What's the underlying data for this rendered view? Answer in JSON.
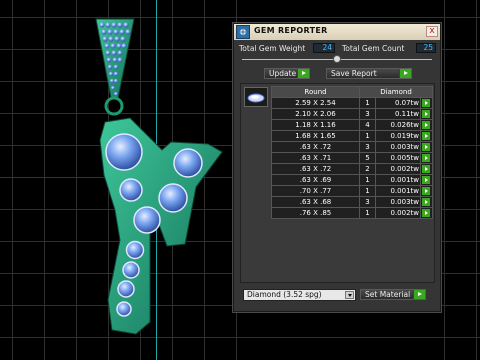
{
  "panel": {
    "title": "GEM REPORTER",
    "close_glyph": "x",
    "total_weight_label": "Total Gem Weight",
    "total_weight_value": "24",
    "total_count_label": "Total Gem Count",
    "total_count_value": "25",
    "update_label": "Update",
    "save_label": "Save Report",
    "table": {
      "headers": [
        "Round",
        "Diamond"
      ],
      "rows": [
        {
          "size": "2.59 X 2.54",
          "count": "1",
          "weight": "0.07tw"
        },
        {
          "size": "2.10 X 2.06",
          "count": "3",
          "weight": "0.11tw"
        },
        {
          "size": "1.18 X 1.16",
          "count": "4",
          "weight": "0.026tw"
        },
        {
          "size": "1.68 X 1.65",
          "count": "1",
          "weight": "0.019tw"
        },
        {
          "size": ".63 X .72",
          "count": "3",
          "weight": "0.003tw"
        },
        {
          "size": ".63 X .71",
          "count": "5",
          "weight": "0.005tw"
        },
        {
          "size": ".63 X .72",
          "count": "2",
          "weight": "0.002tw"
        },
        {
          "size": ".63 X .69",
          "count": "1",
          "weight": "0.001tw"
        },
        {
          "size": ".70 X .77",
          "count": "1",
          "weight": "0.001tw"
        },
        {
          "size": ".63 X .68",
          "count": "3",
          "weight": "0.003tw"
        },
        {
          "size": ".76 X .85",
          "count": "1",
          "weight": "0.002tw"
        }
      ]
    },
    "material_selected": "Diamond   (3.52 spg)",
    "set_material_label": "Set Material"
  },
  "colors": {
    "viewport_bg": "#000000",
    "metal_green": "#1d9a72",
    "gem_blue": "#7aa4f0",
    "panel_bg": "#353535",
    "accent_green": "#39a81e",
    "value_blue": "#49b7ff"
  },
  "icons": [
    "app-icon",
    "close-icon",
    "play-arrow-icon",
    "gem-thumbnail-icon",
    "dropdown-caret-icon"
  ]
}
